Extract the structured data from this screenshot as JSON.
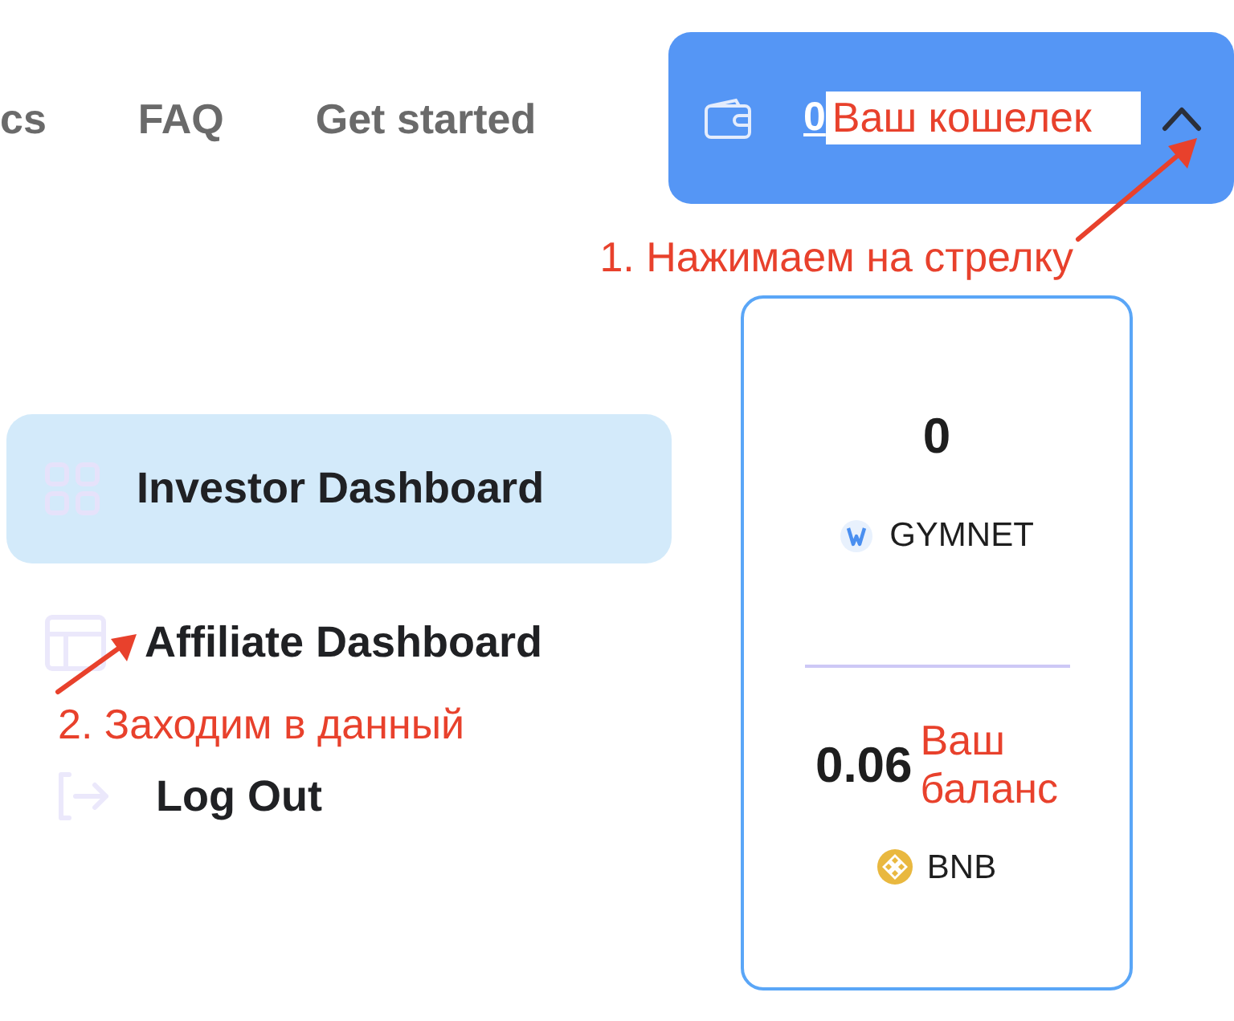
{
  "nav": {
    "links": [
      {
        "label": "cs"
      },
      {
        "label": "FAQ"
      },
      {
        "label": "Get started"
      }
    ]
  },
  "wallet_button": {
    "amount": "0",
    "annotation": "Ваш кошелек",
    "expanded": true
  },
  "hint_1": "1. Нажимаем на стрелку",
  "sidebar": {
    "items": [
      {
        "label": "Investor Dashboard",
        "selected": true
      },
      {
        "label": "Affiliate Dashboard",
        "selected": false
      },
      {
        "label": "Log Out",
        "selected": false
      }
    ],
    "hint_2": "2. Заходим в данный"
  },
  "balance_card": {
    "tokens": [
      {
        "amount": "0",
        "symbol": "GYMNET"
      },
      {
        "amount": "0.06",
        "symbol": "BNB",
        "annotation": "Ваш баланс"
      }
    ]
  }
}
